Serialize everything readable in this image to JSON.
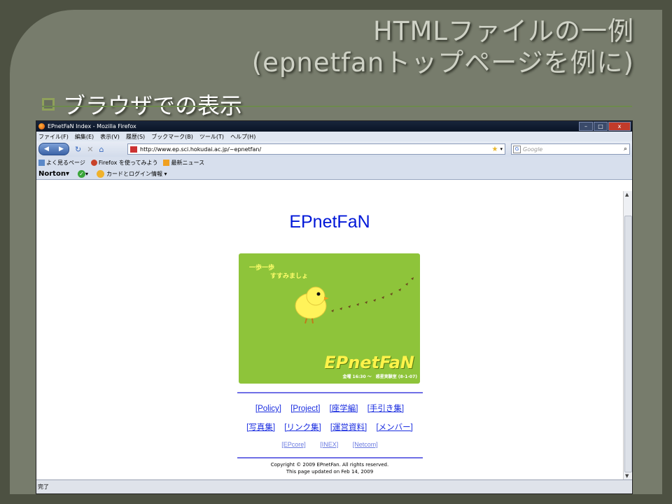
{
  "slide": {
    "title_line1": "HTMLファイルの一例",
    "title_line2": "(epnetfanトップページを例に)",
    "bullet": "ブラウザでの表示"
  },
  "browser": {
    "window_title": "EPnetFaN Index - Mozilla Firefox",
    "window_buttons": [
      "–",
      "□",
      "x"
    ],
    "menu": [
      "ファイル(F)",
      "編集(E)",
      "表示(V)",
      "履歴(S)",
      "ブックマーク(B)",
      "ツール(T)",
      "ヘルプ(H)"
    ],
    "url": "http://www.ep.sci.hokudai.ac.jp/~epnetfan/",
    "search_placeholder": "Google",
    "bookmarks": [
      "よく見るページ",
      "Firefox を使ってみよう",
      "最新ニュース"
    ],
    "norton_label": "Norton",
    "norton_card_label": "カードとログイン情報",
    "status": "完了"
  },
  "page": {
    "title": "EPnetFaN",
    "banner": {
      "note_line1": "一歩一歩",
      "note_line2": "すすみましょ",
      "logo": "EPnetFaN",
      "schedule": "金曜 16:30 〜　惑星実験室 (8-1-07)"
    },
    "links_row1": [
      "[Policy]",
      "[Project]",
      "[座学編]",
      "[手引き集]"
    ],
    "links_row2": [
      "[写真集]",
      "[リンク集]",
      "[運営資料]",
      "[メンバー]"
    ],
    "links_row3": [
      "[EPcore]",
      "[INEX]",
      "[Netcom]"
    ],
    "copyright": "Copyright © 2009 EPnetFan. All rights reserved.",
    "updated": "This page updated on Feb 14, 2009"
  }
}
